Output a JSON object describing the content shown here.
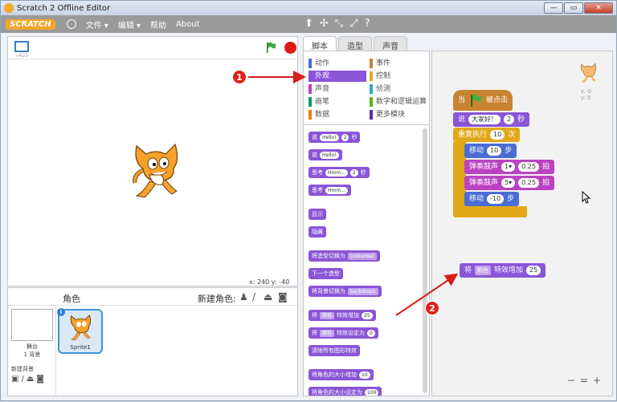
{
  "window": {
    "title": "Scratch 2 Offline Editor"
  },
  "menubar": {
    "logo": "SCRATCH",
    "items": [
      "文件 ▾",
      "编辑 ▾",
      "帮助",
      "About"
    ],
    "tools": [
      "⬆",
      "✢",
      "⤡",
      "⤢",
      "?"
    ]
  },
  "stage": {
    "version": "v423",
    "coords": "x: 240  y: -40"
  },
  "sprites_pane": {
    "label": "角色",
    "new_sprite": "新建角色:",
    "stage_label": "舞台",
    "backdrops": "1 背景",
    "new_backdrop": "新建背景",
    "sprite_name": "Sprite1"
  },
  "tabs": [
    "脚本",
    "造型",
    "声音"
  ],
  "categories": [
    {
      "label": "动作",
      "color": "#4a6cd4"
    },
    {
      "label": "事件",
      "color": "#c88330"
    },
    {
      "label": "外观",
      "color": "#8a55d7"
    },
    {
      "label": "控制",
      "color": "#e1a91a"
    },
    {
      "label": "声音",
      "color": "#bb42c3"
    },
    {
      "label": "侦测",
      "color": "#2ca5e2"
    },
    {
      "label": "画笔",
      "color": "#0e9a6c"
    },
    {
      "label": "数字和逻辑运算",
      "color": "#5cb712"
    },
    {
      "label": "数据",
      "color": "#ee7d16"
    },
    {
      "label": "更多模块",
      "color": "#632d99"
    }
  ],
  "palette_blocks": {
    "say_secs": {
      "text": "说",
      "value": "Hello!",
      "value2": "2",
      "suffix": "秒"
    },
    "say": {
      "text": "说",
      "value": "Hello!"
    },
    "think_secs": {
      "text": "思考",
      "value": "Hmm...",
      "value2": "2",
      "suffix": "秒"
    },
    "think": {
      "text": "思考",
      "value": "Hmm..."
    },
    "show": "显示",
    "hide": "隐藏",
    "switch_costume": {
      "text": "将造型切换为",
      "value": "costume2"
    },
    "next_costume": "下一个造型",
    "switch_backdrop": {
      "text": "将背景切换为",
      "value": "backdrop1"
    },
    "change_effect": {
      "text": "将",
      "dropdown": "颜色",
      "text2": "特效增加",
      "value": "25"
    },
    "set_effect": {
      "text": "将",
      "dropdown": "颜色",
      "text2": "特效设定为",
      "value": "0"
    },
    "clear_effects": "清除所有图形特效",
    "change_size": {
      "text": "将角色的大小增加",
      "value": "10"
    },
    "set_size": {
      "text": "将角色的大小设定为",
      "value": "100"
    }
  },
  "script": {
    "hat": {
      "text": "当",
      "text2": "被点击"
    },
    "say": {
      "text": "说",
      "value": "大家好！",
      "value2": "2",
      "suffix": "秒"
    },
    "repeat": {
      "text": "重复执行",
      "value": "10",
      "suffix": "次"
    },
    "move1": {
      "text": "移动",
      "value": "10",
      "suffix": "步"
    },
    "drum1": {
      "text": "弹奏鼓声",
      "value": "1▾",
      "value2": "0.25",
      "suffix": "拍"
    },
    "drum2": {
      "text": "弹奏鼓声",
      "value": "5▾",
      "value2": "0.25",
      "suffix": "拍"
    },
    "move2": {
      "text": "移动",
      "value": "-10",
      "suffix": "步"
    }
  },
  "dragged_block": {
    "text": "将",
    "dropdown": "颜色",
    "text2": "特效增加",
    "value": "25"
  },
  "sprite_info": {
    "x": "x: 0",
    "y": "y: 0"
  },
  "zoom": [
    "−",
    "=",
    "+"
  ],
  "annotations": [
    "1",
    "2"
  ]
}
